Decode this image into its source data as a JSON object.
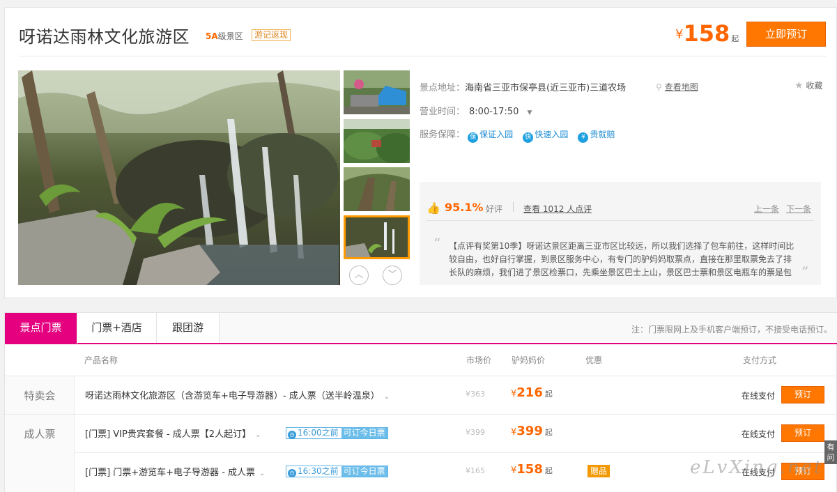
{
  "header": {
    "title": "呀诺达雨林文化旅游区",
    "level_grade": "5A",
    "level_suffix": "级景区",
    "youji_badge": "游记返现",
    "price_currency": "¥",
    "price": "158",
    "price_suffix": "起",
    "book_button": "立即预订"
  },
  "info": {
    "address_label": "景点地址：",
    "address": "海南省三亚市保亭县(近三亚市)三道农场",
    "map_link": "查看地图",
    "favorite": "收藏",
    "hours_label": "营业时间：",
    "hours": "8:00-17:50",
    "service_label": "服务保障：",
    "services": [
      {
        "icon": "保",
        "label": "保证入园"
      },
      {
        "icon": "快",
        "label": "快速入园"
      },
      {
        "icon": "¥",
        "label": "贵就赔"
      }
    ]
  },
  "review": {
    "percent": "95.1%",
    "good_label": "好评",
    "count_link": "查看 1012 人点评",
    "prev": "上一条",
    "next": "下一条",
    "text": "【点评有奖第10季】呀诺达景区距离三亚市区比较远，所以我们选择了包车前往，这样时间比较自由，也好自行掌握，到景区服务中心，有专门的驴妈妈取票点，直接在那里取票免去了排长队的麻烦，我们进了景区检票口，先乘坐景区巴士上山，景区巴士票和景区电瓶车的票是包含 ..."
  },
  "tabs": {
    "items": [
      "景点门票",
      "门票+酒店",
      "跟团游"
    ],
    "note": "注：门票限网上及手机客户端预订，不接受电话预订。"
  },
  "table": {
    "headers": {
      "name": "产品名称",
      "market": "市场价",
      "lv": "驴妈妈价",
      "promo": "优惠",
      "pay": "支付方式"
    },
    "rows": [
      {
        "category": "特卖会",
        "name": "呀诺达雨林文化旅游区（含游览车+电子导游器）- 成人票（送半岭温泉）",
        "market": "¥363",
        "price": "216",
        "pay": "在线支付",
        "button": "预订"
      },
      {
        "category": "成人票",
        "name": "[门票] VIP贵宾套餐 - 成人票【2人起订】",
        "time": "16:00之前",
        "today": "可订今日票",
        "market": "¥399",
        "price": "399",
        "pay": "在线支付",
        "button": "预订"
      },
      {
        "name": "[门票] 门票+游览车+电子导游器 - 成人票",
        "time": "16:30之前",
        "today": "可订今日票",
        "market": "¥165",
        "price": "158",
        "gift": "赠品",
        "pay": "在线支付",
        "button": "预订"
      }
    ],
    "currency": "¥",
    "qi": "起"
  },
  "side_tag": "有问",
  "watermark": "eLvXing.net"
}
